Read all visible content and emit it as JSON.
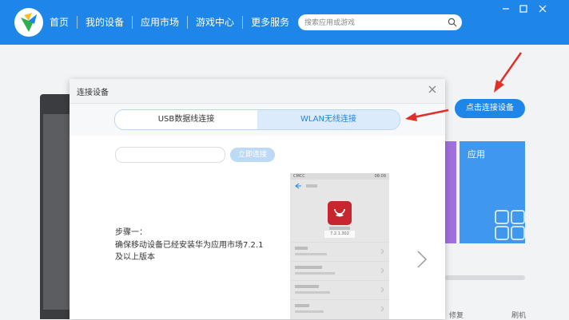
{
  "nav": {
    "items": [
      "首页",
      "我的设备",
      "应用市场",
      "游戏中心",
      "更多服务"
    ]
  },
  "search": {
    "placeholder": "搜索应用或游戏"
  },
  "background": {
    "connect_button": "点击连接设备",
    "tile_label": "应用",
    "text_repair": "修复",
    "text_refresh": "刷机"
  },
  "dialog": {
    "title": "连接设备",
    "tabs": [
      {
        "label": "USB数据线连接",
        "active": false
      },
      {
        "label": "WLAN无线连接",
        "active": true
      }
    ],
    "query_button": "立即连接",
    "step_title": "步骤一：",
    "step_line1": "确保移动设备已经安装华为应用市场7.2.1",
    "step_line2": "及以上版本",
    "phone": {
      "carrier": "CMCC",
      "time": "08:09",
      "version": "7.2.1.302"
    }
  },
  "colors": {
    "brand_blue": "#1e86e8",
    "annotation_red": "#e0302a",
    "tab_active_bg": "#dcebfb",
    "tile_purple": "#a070de",
    "tile_blue": "#3f97ee",
    "app_icon_red": "#c8262e"
  },
  "icons": [
    "app-logo-icon",
    "search-icon",
    "minimize-icon",
    "maximize-icon",
    "close-icon",
    "back-arrow-icon",
    "chevron-right-icon",
    "grid-apps-icon"
  ]
}
